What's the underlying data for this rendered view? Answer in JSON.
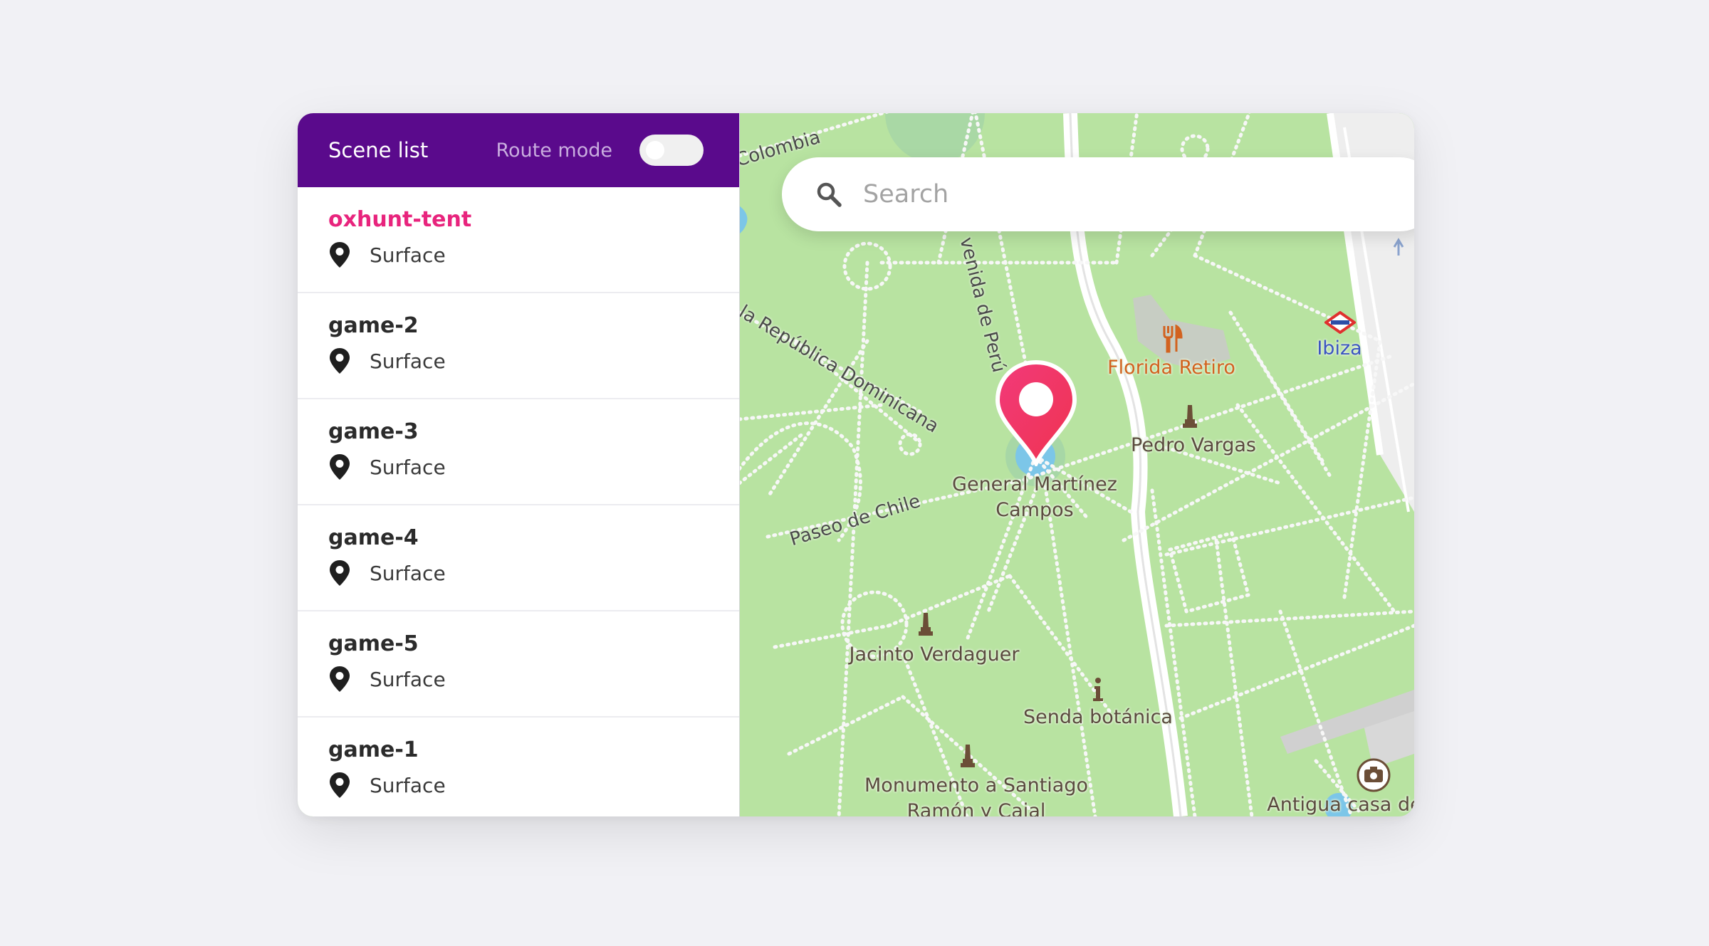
{
  "panel": {
    "title": "Scene list",
    "route_mode_label": "Route mode",
    "route_mode_on": false
  },
  "scenes": [
    {
      "name": "oxhunt-tent",
      "type": "Surface",
      "active": true
    },
    {
      "name": "game-2",
      "type": "Surface",
      "active": false
    },
    {
      "name": "game-3",
      "type": "Surface",
      "active": false
    },
    {
      "name": "game-4",
      "type": "Surface",
      "active": false
    },
    {
      "name": "game-5",
      "type": "Surface",
      "active": false
    },
    {
      "name": "game-1",
      "type": "Surface",
      "active": false
    }
  ],
  "search": {
    "placeholder": "Search",
    "icon": "search-icon"
  },
  "map": {
    "streets": {
      "colombia": "Colombia",
      "republica": "la República Dominicana",
      "peru": "venida de Perú",
      "chile": "Paseo de Chile"
    },
    "places": {
      "martinez_1": "General Martínez",
      "martinez_2": "Campos",
      "florida": "Florida Retiro",
      "ibiza": "Ibiza",
      "vargas": "Pedro Vargas",
      "verdaguer": "Jacinto Verdaguer",
      "senda": "Senda botánica",
      "monumento_1": "Monumento a Santiago",
      "monumento_2": "Ramón y Cajal",
      "antigua": "Antigua casa de"
    },
    "icons": [
      "restaurant-icon",
      "metro-icon",
      "monument-icon",
      "info-icon",
      "camera-icon",
      "map-marker-icon"
    ],
    "colors": {
      "park": "#b8e3a1",
      "path": "#f2f2f2",
      "water": "#7cc6e8",
      "marker": "#f0336a",
      "header": "#5a0a8c",
      "accent": "#e8247d"
    }
  }
}
